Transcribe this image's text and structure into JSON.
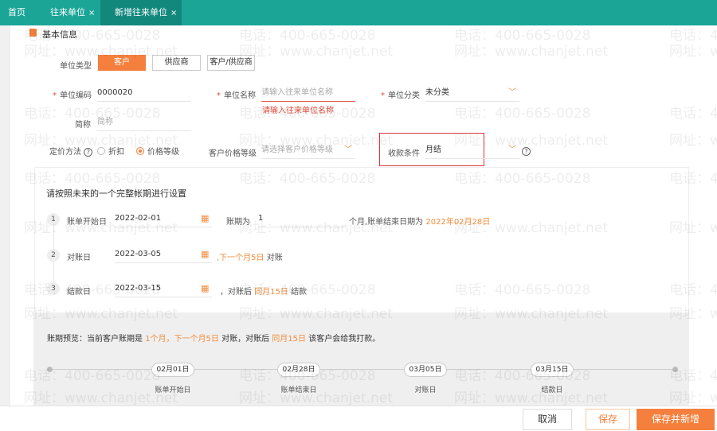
{
  "tabs": [
    {
      "label": "首页"
    },
    {
      "label": "往来单位",
      "close": "×"
    },
    {
      "label": "新增往来单位",
      "close": "×"
    }
  ],
  "section_title": "基本信息",
  "unit_type": {
    "label": "单位类型",
    "options": [
      "客户",
      "供应商",
      "客户/供应商"
    ],
    "selected": "客户"
  },
  "unit_code": {
    "label": "单位编码",
    "value": "0000020"
  },
  "unit_name": {
    "label": "单位名称",
    "placeholder": "请输入往来单位名称",
    "error": "请输入往来单位名称"
  },
  "unit_category": {
    "label": "单位分类",
    "value": "未分类"
  },
  "short_name": {
    "label": "简称",
    "placeholder": "简称"
  },
  "pricing": {
    "label": "定价方法",
    "options": [
      "折扣",
      "价格等级"
    ],
    "selected": "价格等级"
  },
  "price_level": {
    "label": "客户价格等级",
    "placeholder": "请选择客户价格等级"
  },
  "payment_terms": {
    "label": "收款条件",
    "value": "月结"
  },
  "period": {
    "instruction": "请按照未来的一个完整帐期进行设置",
    "step1": {
      "num": "1",
      "label": "账单开始日",
      "date": "2022-02-01",
      "period_label": "账期为",
      "period_value": "1",
      "suffix": "个月,账单结束日期为",
      "end_date": "2022年02月28日"
    },
    "step2": {
      "num": "2",
      "label": "对账日",
      "date": "2022-03-05",
      "note_orange": ",下一个月5日",
      "note": "对账"
    },
    "step3": {
      "num": "3",
      "label": "结款日",
      "date": "2022-03-15",
      "note_prefix": "，对账后",
      "note_orange": "同月15日",
      "note": "结款"
    }
  },
  "preview": {
    "prefix": "账期预览：当前客户账期是",
    "hl1": "1个月，下一个月5日",
    "mid": "对账，对账后",
    "hl2": "同月15日",
    "suffix": "该客户会给我打款。",
    "timeline": [
      {
        "date": "02月01日",
        "label": "账单开始日"
      },
      {
        "date": "02月28日",
        "label": "账单结束日"
      },
      {
        "date": "03月05日",
        "label": "对账日"
      },
      {
        "date": "03月15日",
        "label": "结款日"
      }
    ]
  },
  "footer": {
    "cancel": "取消",
    "save": "保存",
    "save_new": "保存并新增"
  },
  "watermark": {
    "phone": "电话：400-665-0028",
    "site": "网址：www.chanjet.net"
  },
  "colors": {
    "topbar": "#1aa597",
    "accent": "#f5803e"
  }
}
